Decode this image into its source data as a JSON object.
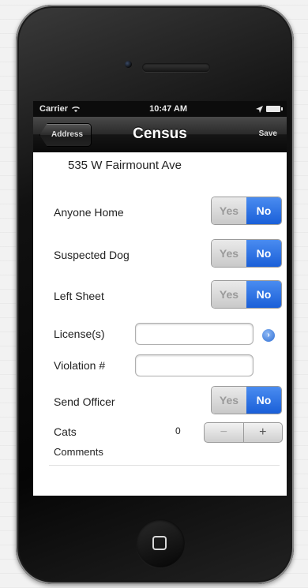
{
  "status_bar": {
    "carrier": "Carrier",
    "time": "10:47 AM"
  },
  "nav": {
    "back_label": "Address",
    "title": "Census",
    "save_label": "Save"
  },
  "address": "535 W Fairmount Ave",
  "fields": {
    "anyone_home": {
      "label": "Anyone Home",
      "yes": "Yes",
      "no": "No",
      "selected": "No"
    },
    "suspected_dog": {
      "label": "Suspected Dog",
      "yes": "Yes",
      "no": "No",
      "selected": "No"
    },
    "left_sheet": {
      "label": "Left Sheet",
      "yes": "Yes",
      "no": "No",
      "selected": "No"
    },
    "licenses": {
      "label": "License(s)",
      "value": ""
    },
    "violation": {
      "label": "Violation #",
      "value": ""
    },
    "send_officer": {
      "label": "Send Officer",
      "yes": "Yes",
      "no": "No",
      "selected": "No"
    },
    "cats": {
      "label": "Cats",
      "count": "0",
      "minus": "−",
      "plus": "+"
    },
    "comments": {
      "label": "Comments",
      "value": ""
    }
  },
  "colors": {
    "selected_segment": "#1a5fd8",
    "navbar": "#151515"
  }
}
